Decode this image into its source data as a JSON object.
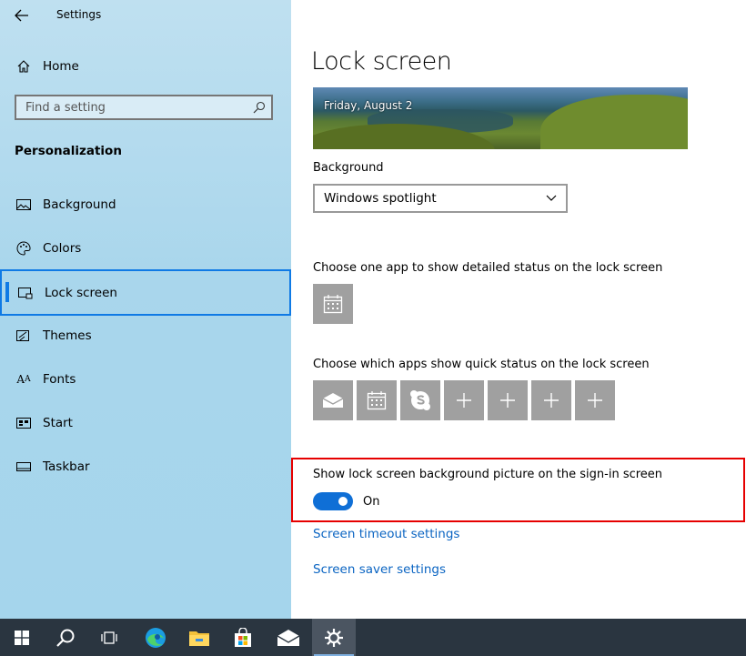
{
  "window": {
    "title": "Settings"
  },
  "sidebar": {
    "home_label": "Home",
    "search_placeholder": "Find a setting",
    "section_heading": "Personalization",
    "items": [
      {
        "label": "Background",
        "icon": "picture-icon"
      },
      {
        "label": "Colors",
        "icon": "palette-icon"
      },
      {
        "label": "Lock screen",
        "icon": "lock-screen-icon",
        "selected": true
      },
      {
        "label": "Themes",
        "icon": "themes-icon"
      },
      {
        "label": "Fonts",
        "icon": "fonts-icon"
      },
      {
        "label": "Start",
        "icon": "start-icon"
      },
      {
        "label": "Taskbar",
        "icon": "taskbar-icon"
      }
    ]
  },
  "main": {
    "title": "Lock screen",
    "preview_date": "Friday, August 2",
    "background_label": "Background",
    "background_value": "Windows spotlight",
    "detailed_status_label": "Choose one app to show detailed status on the lock screen",
    "detailed_status_apps": [
      "calendar-icon"
    ],
    "quick_status_label": "Choose which apps show quick status on the lock screen",
    "quick_status_apps": [
      "mail-icon",
      "calendar-icon",
      "skype-icon",
      "plus-icon",
      "plus-icon",
      "plus-icon",
      "plus-icon"
    ],
    "signin_label": "Show lock screen background picture on the sign-in screen",
    "signin_toggle_state": "On",
    "link_timeout": "Screen timeout settings",
    "link_saver": "Screen saver settings"
  },
  "taskbar": {
    "items": [
      "windows-start-icon",
      "search-icon",
      "task-view-icon",
      "edge-icon",
      "file-explorer-icon",
      "store-icon",
      "mail-icon",
      "settings-icon"
    ],
    "active": "settings-icon"
  },
  "colors": {
    "accent": "#0f7ae5",
    "toggle_on": "#0f6fd6",
    "highlight": "#e60000",
    "link": "#0a64c2",
    "taskbar": "#2a3540"
  }
}
